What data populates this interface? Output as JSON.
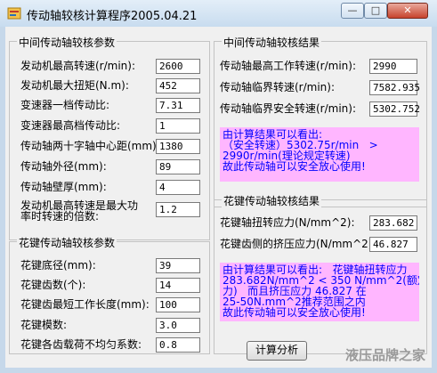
{
  "window": {
    "title": "传动轴较核计算程序2005.04.21"
  },
  "left_group1": {
    "title": "中间传动轴较核参数",
    "rows": [
      {
        "label": "发动机最高转速(r/min):",
        "value": "2600"
      },
      {
        "label": "发动机最大扭矩(N.m):",
        "value": "452"
      },
      {
        "label": "变速器一档传动比:",
        "value": "7.31"
      },
      {
        "label": "变速器最高档传动比:",
        "value": "1"
      },
      {
        "label": "传动轴两十字轴中心距(mm):",
        "value": "1380"
      },
      {
        "label": "传动轴外径(mm):",
        "value": "89"
      },
      {
        "label": "传动轴壁厚(mm):",
        "value": "4"
      },
      {
        "label_line1": "发动机最高转速是最大功",
        "label_line2": "率时转速的倍数:",
        "value": "1.2"
      }
    ]
  },
  "left_group2": {
    "title": "花键传动轴较核参数",
    "rows": [
      {
        "label": "花键底径(mm):",
        "value": "39"
      },
      {
        "label": "花键齿数(个):",
        "value": "14"
      },
      {
        "label": "花键齿最短工作长度(mm):",
        "value": "100"
      },
      {
        "label": "花键模数:",
        "value": "3.0"
      },
      {
        "label": "花键各齿载荷不均匀系数:",
        "value": "0.8"
      }
    ]
  },
  "right_group1": {
    "title": "中间传动轴较核结果",
    "rows": [
      {
        "label": "传动轴最高工作转速(r/min):",
        "value": "2990"
      },
      {
        "label": "传动轴临界转速(r/min):",
        "value": "7582.935"
      },
      {
        "label": "传动轴临界安全转速(r/min):",
        "value": "5302.752"
      }
    ],
    "result_text": "由计算结果可以看出:\n（安全转速）5302.75r/min   >\n2990r/min(理论规定转速)\n故此传动轴可以安全放心使用!"
  },
  "right_group2": {
    "title": "花键传动轴较核结果",
    "rows": [
      {
        "label": "花键轴扭转应力(N/mm^2):",
        "value": "283.682"
      },
      {
        "label": "花键齿侧的挤压应力(N/mm^2):",
        "value": "46.827"
      }
    ],
    "result_text": "由计算结果可以看出:   花键轴扭转应力\n283.682N/mm^2 < 350 N/mm^2(额定扭转应\n力)   而且挤压应力 46.827 在\n25-50N.mm^2推荐范围之内\n故此传动轴可以安全放心使用!"
  },
  "buttons": {
    "calculate": "计算分析"
  },
  "window_controls": {
    "minimize": "—",
    "maximize": "□",
    "close": "✕"
  },
  "watermark": "液压品牌之家"
}
